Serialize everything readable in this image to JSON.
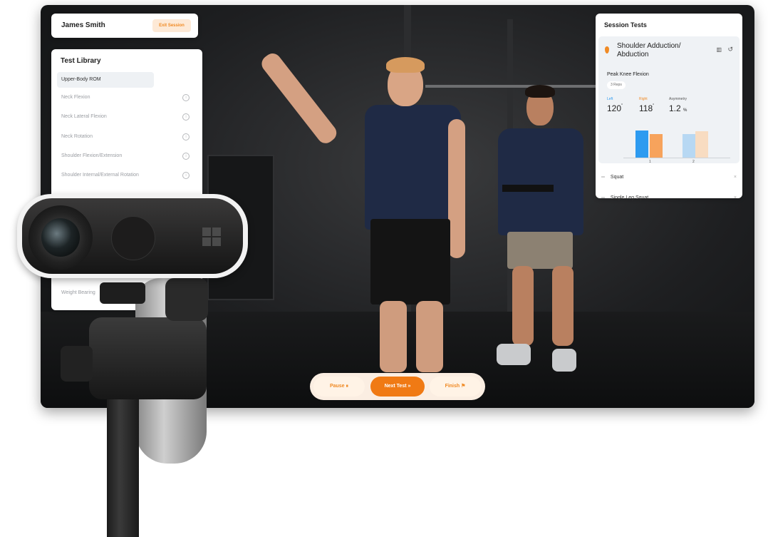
{
  "header": {
    "user_name": "James Smith",
    "exit_label": "Exit Session"
  },
  "library": {
    "title": "Test Library",
    "category": "Upper-Body ROM",
    "items": [
      "Neck Flexion",
      "Neck Lateral Flexion",
      "Neck Rotation",
      "Shoulder Flexion/Extension",
      "Shoulder Internal/External Rotation"
    ],
    "bottom_item": "Weight Bearing"
  },
  "session": {
    "title": "Session Tests",
    "current_test": "Shoulder Adduction/ Abduction",
    "metric_title": "Peak Knee Flexion",
    "reps": "3 Reps",
    "left_label": "Left",
    "left_value": "120",
    "right_label": "Right",
    "right_value": "118",
    "asym_label": "Asymmetry",
    "asym_value": "1.2",
    "asym_unit": "%",
    "degree_symbol": "°",
    "chart_ticks": [
      "1",
      "2"
    ],
    "other_tests": [
      "Squat",
      "Single Leg Squat"
    ],
    "colors": {
      "left": "#2d9bf0",
      "right": "#f7a35c"
    }
  },
  "controls": {
    "pause_label": "Pause",
    "next_label": "Next Test",
    "finish_label": "Finish"
  }
}
